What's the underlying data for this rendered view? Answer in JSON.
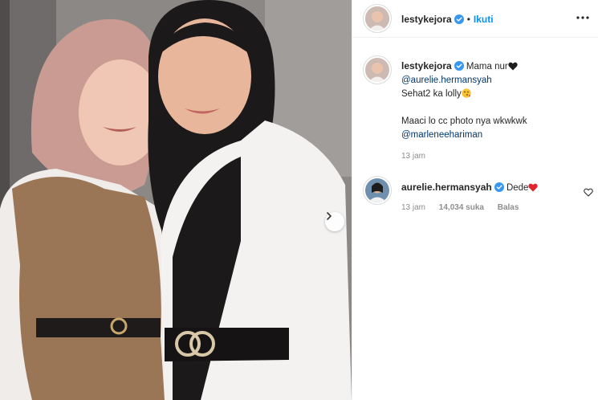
{
  "post": {
    "username": "lestykejora",
    "dot": "•",
    "follow_label": "Ikuti",
    "more_icon": "more-options-icon"
  },
  "caption": {
    "username": "lestykejora",
    "line1_text": "Mama nur",
    "mention1": "@aurelie.hermansyah",
    "line3_text": "Sehat2 ka lolly",
    "line4_text": "Maaci lo cc photo nya wkwkwk",
    "mention2": "@marleneehariman",
    "time": "13 jam"
  },
  "comment": {
    "username": "aurelie.hermansyah",
    "text": "Dede",
    "time": "13 jam",
    "likes": "14,034 suka",
    "reply_label": "Balas"
  },
  "colors": {
    "accent": "#0095f6",
    "link": "#00376b",
    "verified": "#3897f0"
  }
}
